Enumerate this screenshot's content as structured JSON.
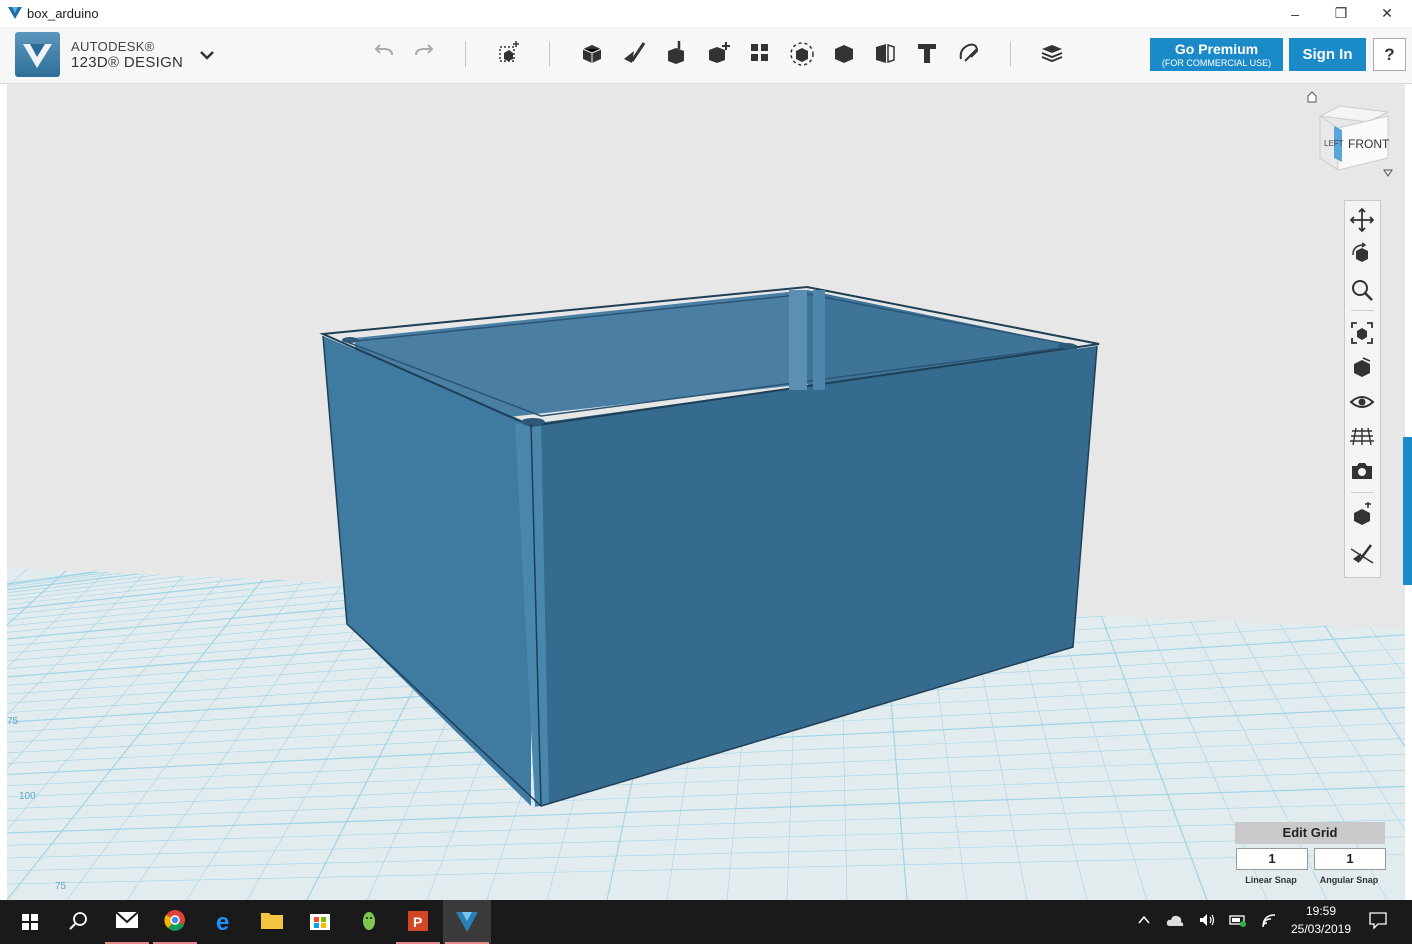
{
  "window": {
    "title": "box_arduino",
    "minimize": "–",
    "restore": "❐",
    "close": "✕"
  },
  "app": {
    "brand_top": "AUTODESK®",
    "brand_bottom": "123D® DESIGN"
  },
  "toolbar": {
    "undo": "undo-icon",
    "redo": "redo-icon",
    "tools": [
      "new-primitive-icon",
      "primitives-icon",
      "sketch-icon",
      "construct-icon",
      "modify-icon",
      "pattern-icon",
      "group-icon",
      "combine-icon",
      "measure-icon",
      "text-icon",
      "snap-icon",
      "material-icon"
    ]
  },
  "account": {
    "premium_label": "Go Premium",
    "premium_sub": "(FOR COMMERCIAL USE)",
    "signin_label": "Sign In",
    "help_label": "?"
  },
  "viewcube": {
    "left": "LEFT",
    "front": "FRONT"
  },
  "nav_tools": [
    "pan-icon",
    "orbit-icon",
    "zoom-icon",
    "fit-icon",
    "view-icon",
    "visibility-icon",
    "grid-icon",
    "camera-icon",
    "material-toggle-icon",
    "hide-sketch-icon"
  ],
  "grid": {
    "edit_label": "Edit Grid",
    "linear_snap_value": "1",
    "angular_snap_value": "1",
    "linear_snap_label": "Linear Snap",
    "angular_snap_label": "Angular Snap",
    "axis_labels": [
      "75",
      "100",
      "75"
    ]
  },
  "taskbar": {
    "apps": [
      "windows-start-icon",
      "search-icon",
      "mail-icon",
      "chrome-icon",
      "edge-icon",
      "file-explorer-icon",
      "store-icon",
      "android-app-icon",
      "powerpoint-icon",
      "123d-design-icon"
    ],
    "time": "19:59",
    "date": "25/03/2019"
  },
  "colors": {
    "accent": "#1b8ac9",
    "model": "#3a6f93",
    "grid_line": "#8ccde4"
  }
}
